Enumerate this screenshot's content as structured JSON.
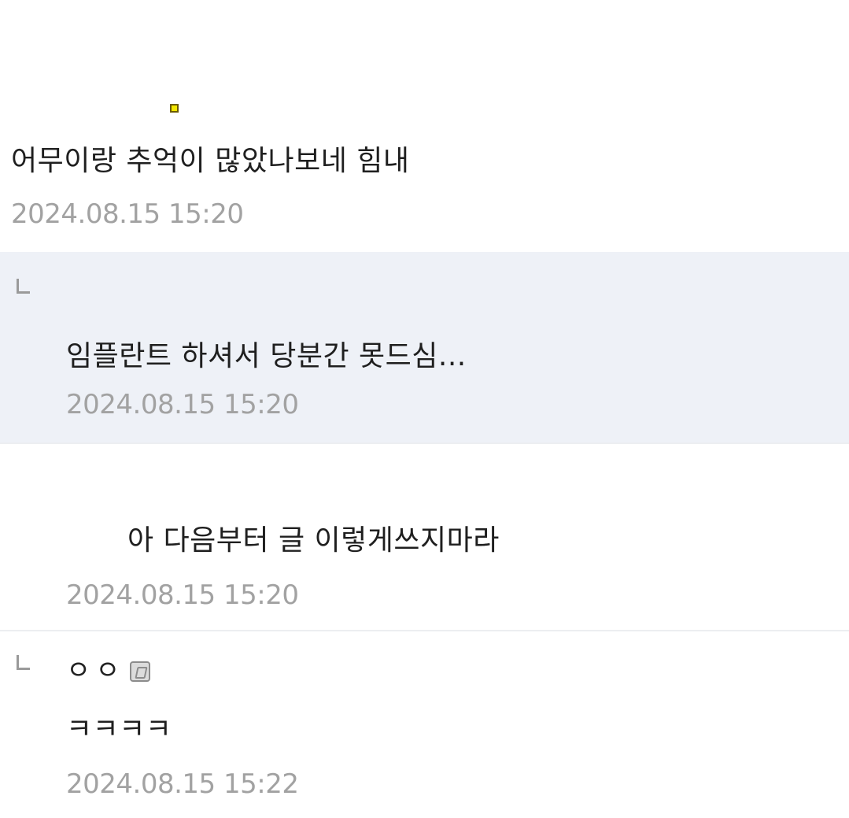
{
  "comments": [
    {
      "text": "어무이랑 추억이 많았나보네 힘내",
      "time": "2024.08.15 15:20"
    },
    {
      "reply": true,
      "text": "임플란트 하셔서 당분간 못드심...",
      "time": "2024.08.15 15:20"
    },
    {
      "text": "아 다음부터 글 이렇게쓰지마라",
      "time": "2024.08.15 15:20"
    },
    {
      "reply": true,
      "nickname": "ㅇㅇ",
      "writer_icon": "writer-badge-icon",
      "text": "ㅋㅋㅋㅋ",
      "time": "2024.08.15 15:22"
    }
  ],
  "colors": {
    "reply_background": "#eef1f7",
    "timestamp": "#a2a2a2",
    "divider": "#eceef1"
  }
}
